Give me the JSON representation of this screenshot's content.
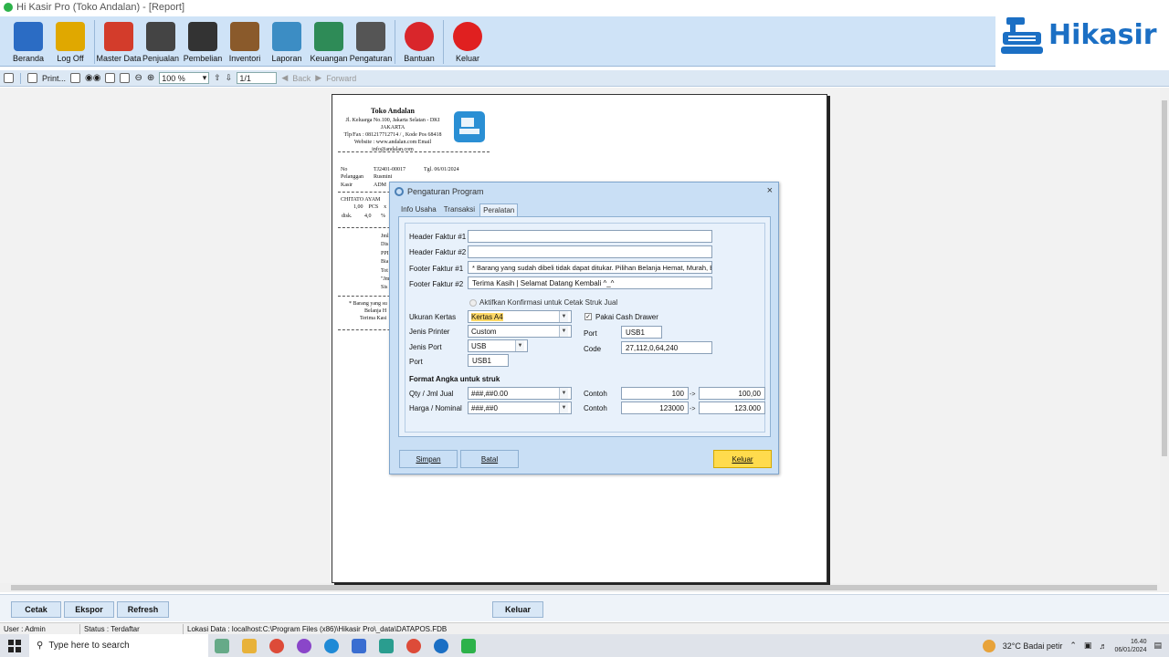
{
  "window": {
    "title": "Hi Kasir Pro (Toko Andalan) - [Report]"
  },
  "logo": {
    "text": "Hikasir"
  },
  "toolbar": {
    "items": [
      {
        "label": "Beranda",
        "icon": "home-chart-icon",
        "color": "#2b6cc4"
      },
      {
        "label": "Log Off",
        "icon": "lock-icon",
        "color": "#e0a800"
      },
      {
        "label": "Master Data",
        "icon": "boxes-icon",
        "color": "#d33c2b"
      },
      {
        "label": "Penjualan",
        "icon": "cashier-icon",
        "color": "#444444"
      },
      {
        "label": "Pembelian",
        "icon": "cart-icon",
        "color": "#333333"
      },
      {
        "label": "Inventori",
        "icon": "warehouse-icon",
        "color": "#8a5a2b"
      },
      {
        "label": "Laporan",
        "icon": "report-icon",
        "color": "#3c8dc4"
      },
      {
        "label": "Keuangan",
        "icon": "money-icon",
        "color": "#2e8b57"
      },
      {
        "label": "Pengaturan",
        "icon": "gear-icon",
        "color": "#555555"
      },
      {
        "label": "Bantuan",
        "icon": "help-icon",
        "color": "#d9262b"
      },
      {
        "label": "Keluar",
        "icon": "power-icon",
        "color": "#e02020"
      }
    ]
  },
  "report_toolbar": {
    "print": "Print...",
    "zoom": "100 %",
    "page": "1/1",
    "back": "Back",
    "forward": "Forward"
  },
  "receipt": {
    "store": "Toko Andalan",
    "addr1": "Jl. Keluarga No.100, Jakarta Selatan - DKI",
    "addr2": "JAKARTA",
    "addr3": "Tlp/Fax : 081217712714 / , Kode Pos 68418",
    "addr4": "Website : www.andalan.com Email",
    "addr5": "info@andalan.com",
    "no_label": "No",
    "no_value": "TJ2401-00017",
    "tgl": "Tgl. 06/01/2024",
    "pel_label": "Pelanggan",
    "pel_value": "Rusmini",
    "kasir_label": "Kasir",
    "kasir_value": "ADM",
    "item": "CHITATO AYAM",
    "qty": "1,00    PCS    x",
    "disk": "disk.         4,0       %",
    "jml": "Jml",
    "dis": "Dis",
    "ppn": "PPI",
    "bia": "Bia",
    "tot": "Tot",
    "jml2": "\"Jml",
    "sis": "Sis",
    "foot1": "* Barang yang su",
    "foot2": "Belanja H",
    "foot3": "Terima Kasi"
  },
  "dialog": {
    "title": "Pengaturan Program",
    "tabs": [
      "Info Usaha",
      "Transaksi",
      "Peralatan"
    ],
    "header1_label": "Header Faktur #1",
    "header1_value": "",
    "header2_label": "Header Faktur #2",
    "header2_value": "",
    "footer1_label": "Footer Faktur #1",
    "footer1_value": "* Barang yang sudah dibeli tidak dapat ditukar.   Pilihan Belanja Hemat, Murah, Bisa",
    "footer2_label": "Footer Faktur #2",
    "footer2_value": "Terima Kasih | Selamat Datang Kembali  ^_^",
    "confirm_label": "Aktifkan Konfirmasi untuk Cetak Struk Jual",
    "paper_label": "Ukuran Kertas",
    "paper_value": "Kertas A4",
    "printer_label": "Jenis Printer",
    "printer_value": "Custom",
    "port_type_label": "Jenis Port",
    "port_type_value": "USB",
    "port_label": "Port",
    "port_value": "USB1",
    "cash_drawer_label": "Pakai Cash Drawer",
    "cd_port_label": "Port",
    "cd_port_value": "USB1",
    "code_label": "Code",
    "code_value": "27,112,0,64,240",
    "format_title": "Format Angka untuk struk",
    "qty_label": "Qty / Jml Jual",
    "qty_format": "###,##0.00",
    "harga_label": "Harga / Nominal",
    "harga_format": "###,##0",
    "contoh_label": "Contoh",
    "qty_example_in": "100",
    "qty_example_out": "100,00",
    "harga_example_in": "123000",
    "harga_example_out": "123.000",
    "arrow": "->",
    "save": "Simpan",
    "cancel": "Batal",
    "exit": "Keluar"
  },
  "bottom": {
    "cetak": "Cetak",
    "ekspor": "Ekspor",
    "refresh": "Refresh",
    "keluar": "Keluar"
  },
  "status": {
    "user": "User : Admin",
    "state": "Status : Terdaftar",
    "location": "Lokasi Data : localhost:C:\\Program Files (x86)\\Hikasir Pro\\_data\\DATAPOS.FDB"
  },
  "taskbar": {
    "search": "Type here to search",
    "weather": "32°C  Badai petir",
    "time": "16.40",
    "date": "06/01/2024"
  }
}
